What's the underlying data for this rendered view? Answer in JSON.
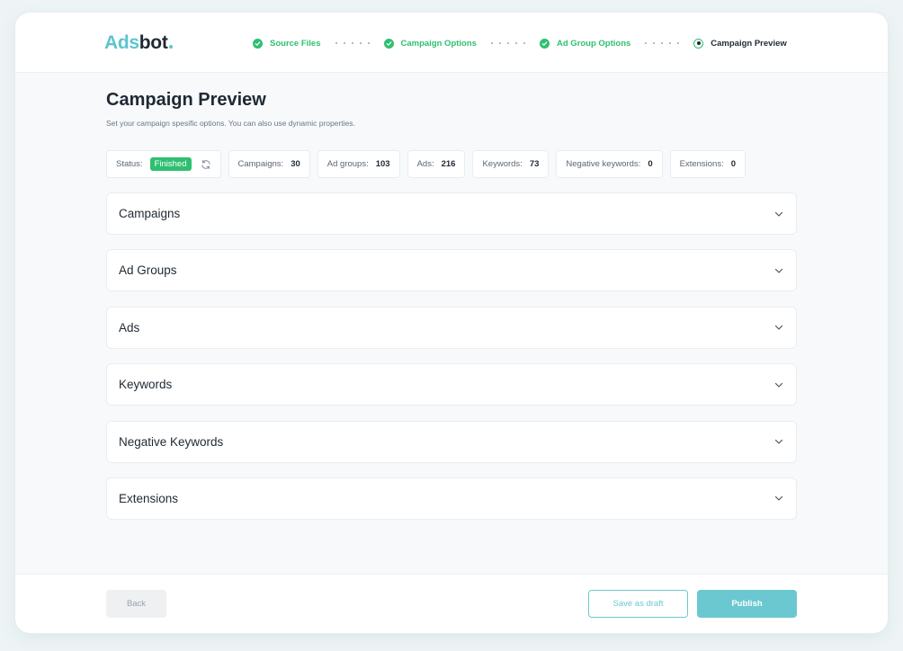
{
  "brand": {
    "logo_part1": "Ads",
    "logo_part2": "bot"
  },
  "stepper": {
    "steps": [
      {
        "label": "Source Files",
        "state": "done"
      },
      {
        "label": "Campaign Options",
        "state": "done"
      },
      {
        "label": "Ad Group Options",
        "state": "done"
      },
      {
        "label": "Campaign Preview",
        "state": "current"
      }
    ]
  },
  "page": {
    "title": "Campaign Preview",
    "subtitle": "Set your campaign spesific options. You can also use dynamic properties."
  },
  "stats": {
    "status_label": "Status:",
    "status_value": "Finished",
    "campaigns_label": "Campaigns:",
    "campaigns_value": "30",
    "ad_groups_label": "Ad groups:",
    "ad_groups_value": "103",
    "ads_label": "Ads:",
    "ads_value": "216",
    "keywords_label": "Keywords:",
    "keywords_value": "73",
    "negative_keywords_label": "Negative keywords:",
    "negative_keywords_value": "0",
    "extensions_label": "Extensions:",
    "extensions_value": "0"
  },
  "panels": [
    {
      "title": "Campaigns"
    },
    {
      "title": "Ad Groups"
    },
    {
      "title": "Ads"
    },
    {
      "title": "Keywords"
    },
    {
      "title": "Negative Keywords"
    },
    {
      "title": "Extensions"
    }
  ],
  "footer": {
    "back_label": "Back",
    "draft_label": "Save as draft",
    "publish_label": "Publish"
  },
  "colors": {
    "accent_teal": "#6cc8d0",
    "success_green": "#2fbf71",
    "text_dark": "#1f2933"
  },
  "icons": {
    "step_done": "check-circle-icon",
    "step_current": "current-step-icon",
    "refresh": "refresh-icon",
    "panel_toggle": "chevron-down-icon"
  }
}
